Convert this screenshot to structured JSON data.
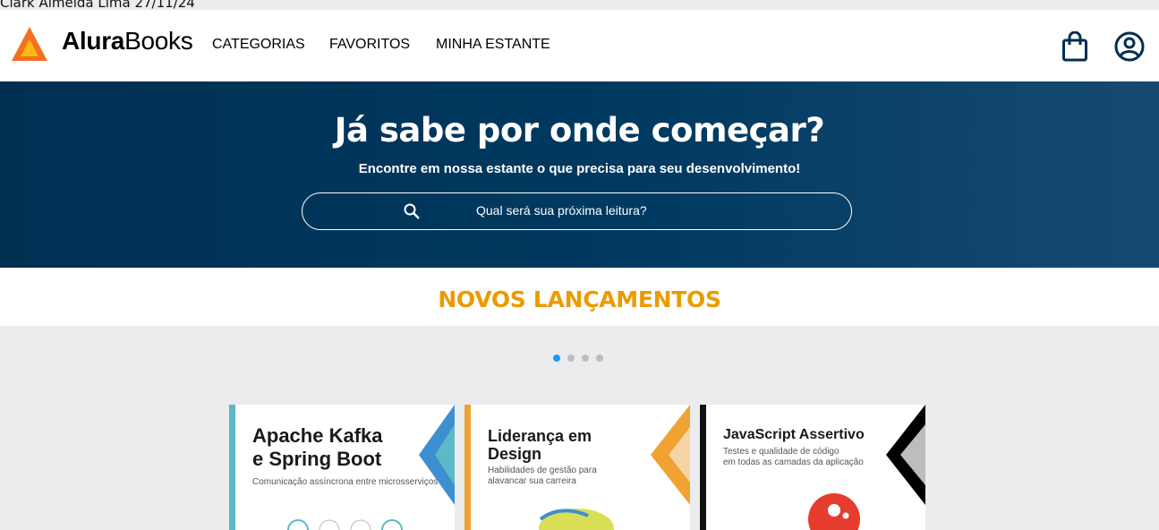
{
  "topline": "Clark Almeida Lima 27/11/24",
  "header": {
    "brand_bold": "Alura",
    "brand_light": "Books",
    "nav": [
      "CATEGORIAS",
      "FAVORITOS",
      "MINHA ESTANTE"
    ],
    "icons": [
      "shopping-bag-icon",
      "user-account-icon"
    ]
  },
  "hero": {
    "title": "Já sabe por onde começar?",
    "subtitle": "Encontre em nossa estante o que precisa para seu desenvolvimento!",
    "search_placeholder": "Qual será sua próxima leitura?"
  },
  "releases": {
    "title": "NOVOS LANÇAMENTOS",
    "carousel_dots": 4,
    "active_dot": 0,
    "books": [
      {
        "title_l1": "Apache Kafka",
        "title_l2": "e Spring Boot",
        "subtitle": "Comunicação assíncrona entre microsserviços",
        "accent": "#3E8FD0"
      },
      {
        "title_l1": "Liderança em",
        "title_l2": "Design",
        "subtitle_l1": "Habilidades de gestão para",
        "subtitle_l2": "alavancar sua carreira",
        "accent": "#F0A232"
      },
      {
        "title_l1": "JavaScript Assertivo",
        "subtitle_l1": "Testes e qualidade de código",
        "subtitle_l2": "em todas as camadas da aplicação",
        "accent": "#000000"
      }
    ]
  },
  "colors": {
    "hero_bg": "#002F52",
    "accent_orange": "#EB9B00",
    "active_dot": "#2196F3",
    "page_bg": "#EBECEE"
  }
}
